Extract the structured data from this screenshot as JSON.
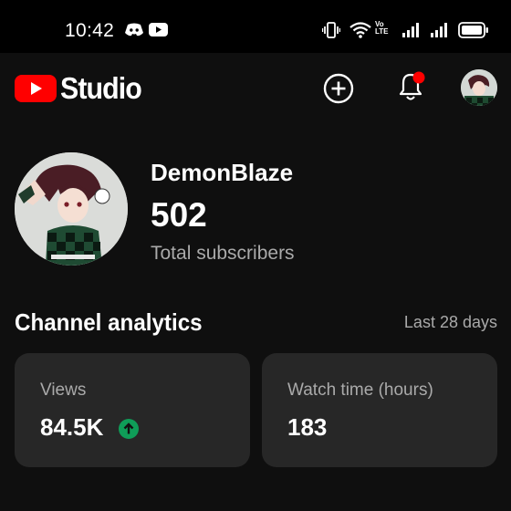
{
  "status_bar": {
    "time": "10:42",
    "left_icons": [
      "discord-icon",
      "youtube-icon"
    ],
    "right_icons": [
      "vibrate-icon",
      "wifi-icon",
      "volte-icon",
      "signal-icon",
      "signal-icon",
      "battery-icon"
    ],
    "volte_label": "Vo\nLTE"
  },
  "app_bar": {
    "logo_text": "Studio",
    "brand_color": "#ff0000",
    "notification_badge_color": "#ff0000",
    "actions": [
      "create-icon",
      "notifications-icon",
      "account-avatar"
    ]
  },
  "channel": {
    "name": "DemonBlaze",
    "subscriber_count": "502",
    "subscriber_label": "Total subscribers"
  },
  "analytics": {
    "title": "Channel analytics",
    "period": "Last 28 days",
    "cards": [
      {
        "label": "Views",
        "value": "84.5K",
        "trend": "up",
        "trend_color": "#0f9d58"
      },
      {
        "label": "Watch time (hours)",
        "value": "183"
      }
    ]
  }
}
